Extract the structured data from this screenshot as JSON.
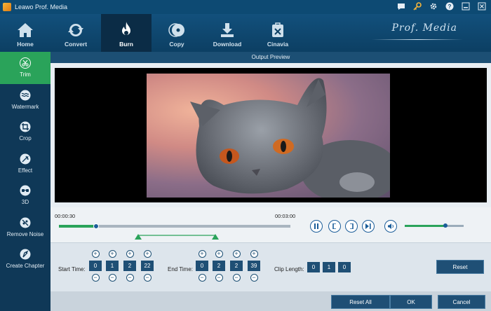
{
  "app": {
    "title": "Leawo Prof. Media",
    "brand": "Prof. Media"
  },
  "toolbar": {
    "tabs": [
      {
        "label": "Home",
        "icon": "home-icon"
      },
      {
        "label": "Convert",
        "icon": "convert-icon"
      },
      {
        "label": "Burn",
        "icon": "burn-icon",
        "active": true
      },
      {
        "label": "Copy",
        "icon": "copy-icon"
      },
      {
        "label": "Download",
        "icon": "download-icon"
      },
      {
        "label": "Cinavia",
        "icon": "cinavia-icon"
      }
    ]
  },
  "sidebar": {
    "items": [
      {
        "label": "Trim",
        "icon": "scissors-icon",
        "active": true
      },
      {
        "label": "Watermark",
        "icon": "watermark-icon"
      },
      {
        "label": "Crop",
        "icon": "crop-icon"
      },
      {
        "label": "Effect",
        "icon": "effect-icon"
      },
      {
        "label": "3D",
        "icon": "3d-glasses-icon"
      },
      {
        "label": "Remove Noise",
        "icon": "remove-noise-icon"
      },
      {
        "label": "Create Chapter",
        "icon": "create-chapter-icon"
      }
    ]
  },
  "preview": {
    "header": "Output Preview"
  },
  "timeline": {
    "start_time": "00:00:30",
    "end_time": "00:03:00",
    "playback_progress": 0.16,
    "volume_level": 0.69
  },
  "trim": {
    "start_label": "Start Time:",
    "start_values": [
      "0",
      "1",
      "2",
      "22"
    ],
    "end_label": "End Time:",
    "end_values": [
      "0",
      "2",
      "2",
      "39"
    ],
    "clip_label": "Clip Length:",
    "clip_values": [
      "0",
      "1",
      "0"
    ],
    "reset_label": "Reset"
  },
  "footer": {
    "reset_all": "Reset All",
    "ok": "OK",
    "cancel": "Cancel"
  },
  "colors": {
    "accent_green": "#2aa35a",
    "primary_blue": "#1f4f75",
    "toolbar": "#12507c"
  }
}
